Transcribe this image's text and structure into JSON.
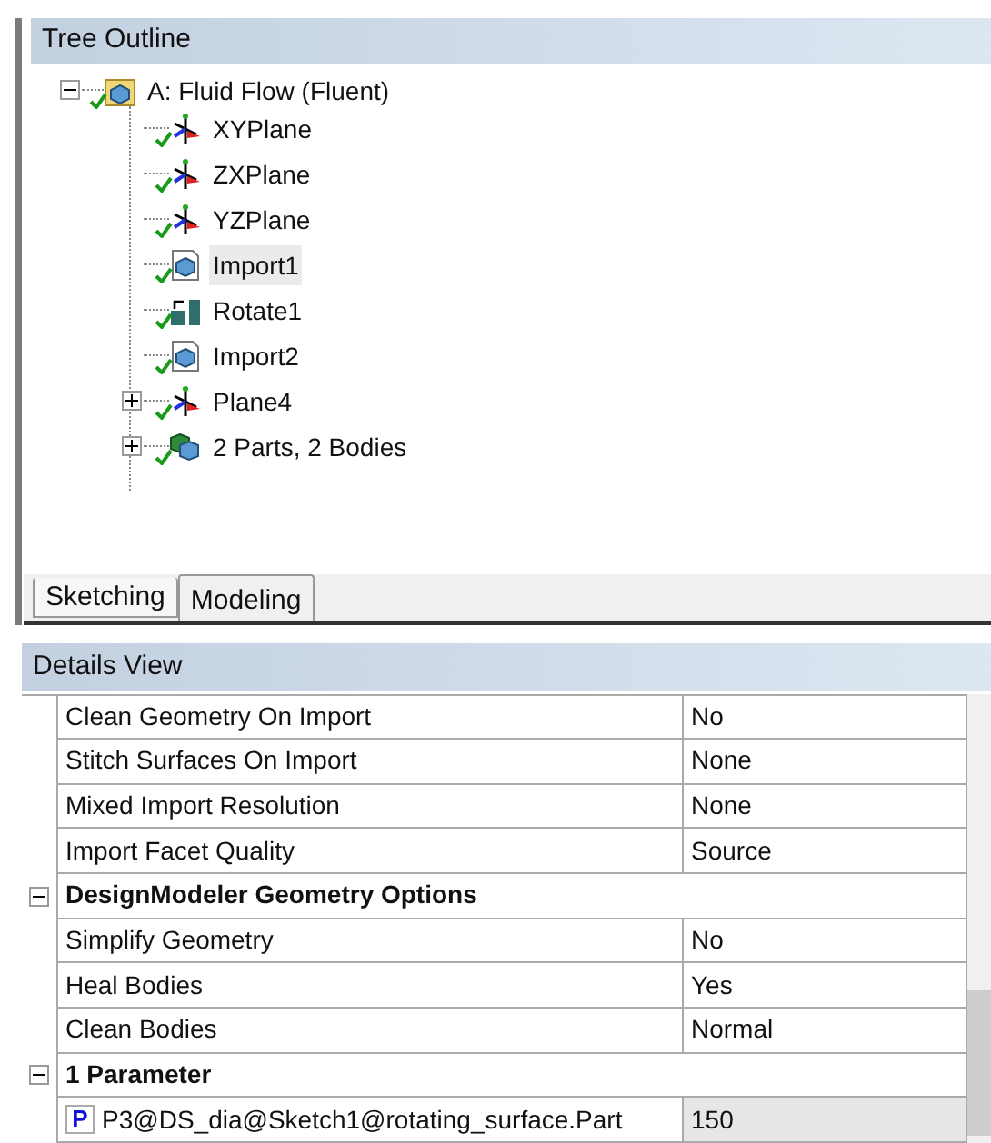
{
  "tree_outline": {
    "title": "Tree Outline",
    "root": {
      "label": "A: Fluid Flow (Fluent)",
      "kind": "assembly",
      "expanded": true,
      "selected": false,
      "children": [
        {
          "label": "XYPlane",
          "kind": "plane",
          "selected": false
        },
        {
          "label": "ZXPlane",
          "kind": "plane",
          "selected": false
        },
        {
          "label": "YZPlane",
          "kind": "plane",
          "selected": false
        },
        {
          "label": "Import1",
          "kind": "import",
          "selected": true
        },
        {
          "label": "Rotate1",
          "kind": "rotate",
          "selected": false
        },
        {
          "label": "Import2",
          "kind": "import",
          "selected": false
        },
        {
          "label": "Plane4",
          "kind": "plane",
          "selected": false,
          "expanded": false
        },
        {
          "label": "2 Parts, 2 Bodies",
          "kind": "bodies",
          "selected": false,
          "expanded": false
        }
      ]
    }
  },
  "tabs": [
    {
      "label": "Sketching",
      "selected": false
    },
    {
      "label": "Modeling",
      "selected": true
    }
  ],
  "details_view": {
    "title": "Details View",
    "rows": [
      {
        "kind": "property",
        "name": "Clean Geometry On Import",
        "value": "No"
      },
      {
        "kind": "property",
        "name": "Stitch Surfaces On Import",
        "value": "None"
      },
      {
        "kind": "property",
        "name": "Mixed Import Resolution",
        "value": "None"
      },
      {
        "kind": "property",
        "name": "Import Facet Quality",
        "value": "Source"
      },
      {
        "kind": "group",
        "name": "DesignModeler Geometry Options",
        "expanded": true
      },
      {
        "kind": "property",
        "name": "Simplify Geometry",
        "value": "No"
      },
      {
        "kind": "property",
        "name": "Heal Bodies",
        "value": "Yes"
      },
      {
        "kind": "property",
        "name": "Clean Bodies",
        "value": "Normal"
      },
      {
        "kind": "group",
        "name": "1 Parameter",
        "expanded": true
      },
      {
        "kind": "parameter",
        "badge": "P",
        "name": "P3@DS_dia@Sketch1@rotating_surface.Part",
        "value": "150"
      }
    ]
  }
}
